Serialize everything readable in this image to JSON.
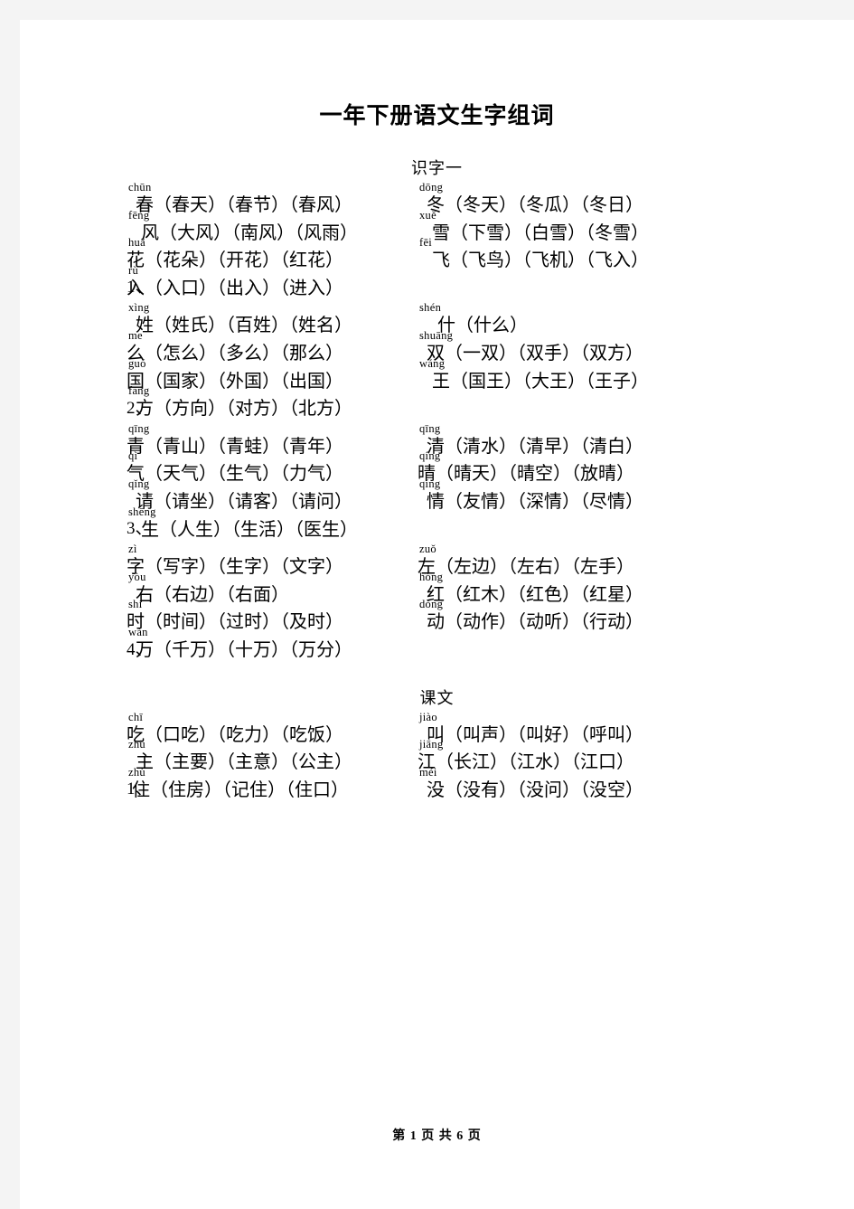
{
  "document": {
    "title": "一年下册语文生字组词",
    "footer": "第 1 页 共 6 页"
  },
  "sections": [
    {
      "heading": "识字一",
      "blocks": [
        {
          "number": "1、",
          "rows": [
            {
              "left": {
                "pinyin": "chūn",
                "hanzi": "春",
                "words": "（春天）（春节）（春风）",
                "indent": 1
              },
              "right": {
                "pinyin": "dōng",
                "hanzi": "冬",
                "words": "（冬天）（冬瓜）（冬日）",
                "indent": 1
              }
            },
            {
              "left": {
                "pinyin": "fēng",
                "hanzi": "风",
                "words": "（大风）（南风）（风雨）",
                "indent": 2
              },
              "right": {
                "pinyin": "xuě",
                "hanzi": "雪",
                "words": "（下雪）（白雪）（冬雪）",
                "indent": 2
              }
            },
            {
              "left": {
                "pinyin": "huā",
                "hanzi": "花",
                "words": "（花朵）（开花）（红花）",
                "indent": 0
              },
              "right": {
                "pinyin": "fēi",
                "hanzi": "飞",
                "words": "（飞鸟）（飞机）（飞入）",
                "indent": 2
              }
            },
            {
              "left": {
                "pinyin": "rù",
                "hanzi": "入",
                "words": "（入口）（出入）（进入）",
                "indent": 0
              },
              "right": null
            }
          ]
        },
        {
          "number": "2、",
          "rows": [
            {
              "left": {
                "pinyin": "xìng",
                "hanzi": "姓",
                "words": "（姓氏）（百姓）（姓名）",
                "indent": 1
              },
              "right": {
                "pinyin": "shén",
                "hanzi": "什",
                "words": "（什么）",
                "indent": 3
              }
            },
            {
              "left": {
                "pinyin": "me",
                "hanzi": "么",
                "words": "（怎么）（多么）（那么）",
                "indent": 0
              },
              "right": {
                "pinyin": "shuāng",
                "hanzi": "双",
                "words": "（一双）（双手）（双方）",
                "indent": 1
              }
            },
            {
              "left": {
                "pinyin": "guó",
                "hanzi": "国",
                "words": "（国家）（外国）（出国）",
                "indent": 0
              },
              "right": {
                "pinyin": "wáng",
                "hanzi": "王",
                "words": "（国王）（大王）（王子）",
                "indent": 2
              }
            },
            {
              "left": {
                "pinyin": "fāng",
                "hanzi": "方",
                "words": "（方向）（对方）（北方）",
                "indent": 1
              },
              "right": null
            }
          ]
        },
        {
          "number": "3、",
          "rows": [
            {
              "left": {
                "pinyin": "qīng",
                "hanzi": "青",
                "words": "（青山）（青蛙）（青年）",
                "indent": 0
              },
              "right": {
                "pinyin": "qīng",
                "hanzi": "清",
                "words": "（清水）（清早）（清白）",
                "indent": 1
              }
            },
            {
              "left": {
                "pinyin": "qì",
                "hanzi": "气",
                "words": "（天气）（生气）（力气）",
                "indent": 0
              },
              "right": {
                "pinyin": "qíng",
                "hanzi": "晴",
                "words": "（晴天）（晴空）（放晴）",
                "indent": 0
              }
            },
            {
              "left": {
                "pinyin": "qǐng",
                "hanzi": "请",
                "words": "（请坐）（请客）（请问）",
                "indent": 1
              },
              "right": {
                "pinyin": "qíng",
                "hanzi": "情",
                "words": "（友情）（深情）（尽情）",
                "indent": 1
              }
            },
            {
              "left": {
                "pinyin": "shēng",
                "hanzi": "生",
                "words": "（人生）（生活）（医生）",
                "indent": 2
              },
              "right": null
            }
          ]
        },
        {
          "number": "4、",
          "rows": [
            {
              "left": {
                "pinyin": "zì",
                "hanzi": "字",
                "words": "（写字）（生字）（文字）",
                "indent": 0
              },
              "right": {
                "pinyin": "zuǒ",
                "hanzi": "左",
                "words": "（左边）（左右）（左手）",
                "indent": 0
              }
            },
            {
              "left": {
                "pinyin": "yòu",
                "hanzi": "右",
                "words": "（右边）（右面）",
                "indent": 1
              },
              "right": {
                "pinyin": "hóng",
                "hanzi": "红",
                "words": "（红木）（红色）（红星）",
                "indent": 1
              }
            },
            {
              "left": {
                "pinyin": "shí",
                "hanzi": "时",
                "words": "（时间）（过时）（及时）",
                "indent": 0
              },
              "right": {
                "pinyin": "dòng",
                "hanzi": "动",
                "words": "（动作）（动听）（行动）",
                "indent": 1
              }
            },
            {
              "left": {
                "pinyin": "wàn",
                "hanzi": "万",
                "words": "（千万）（十万）（万分）",
                "indent": 1
              },
              "right": null
            }
          ]
        }
      ]
    },
    {
      "heading": "课文",
      "blocks": [
        {
          "number": "1、",
          "rows": [
            {
              "left": {
                "pinyin": "chī",
                "hanzi": "吃",
                "words": "（口吃）（吃力）（吃饭）",
                "indent": 0
              },
              "right": {
                "pinyin": "jiào",
                "hanzi": "叫",
                "words": "（叫声）（叫好）（呼叫）",
                "indent": 1
              }
            },
            {
              "left": {
                "pinyin": "zhǔ",
                "hanzi": "主",
                "words": "（主要）（主意）（公主）",
                "indent": 1
              },
              "right": {
                "pinyin": "jiāng",
                "hanzi": "江",
                "words": "（长江）（江水）（江口）",
                "indent": 0
              }
            },
            {
              "left": {
                "pinyin": "zhù",
                "hanzi": "住",
                "words": "（住房）（记住）（住口）",
                "indent": 4
              },
              "right": {
                "pinyin": "méi",
                "hanzi": "没",
                "words": "（没有）（没问）（没空）",
                "indent": 1
              }
            }
          ]
        }
      ]
    }
  ]
}
